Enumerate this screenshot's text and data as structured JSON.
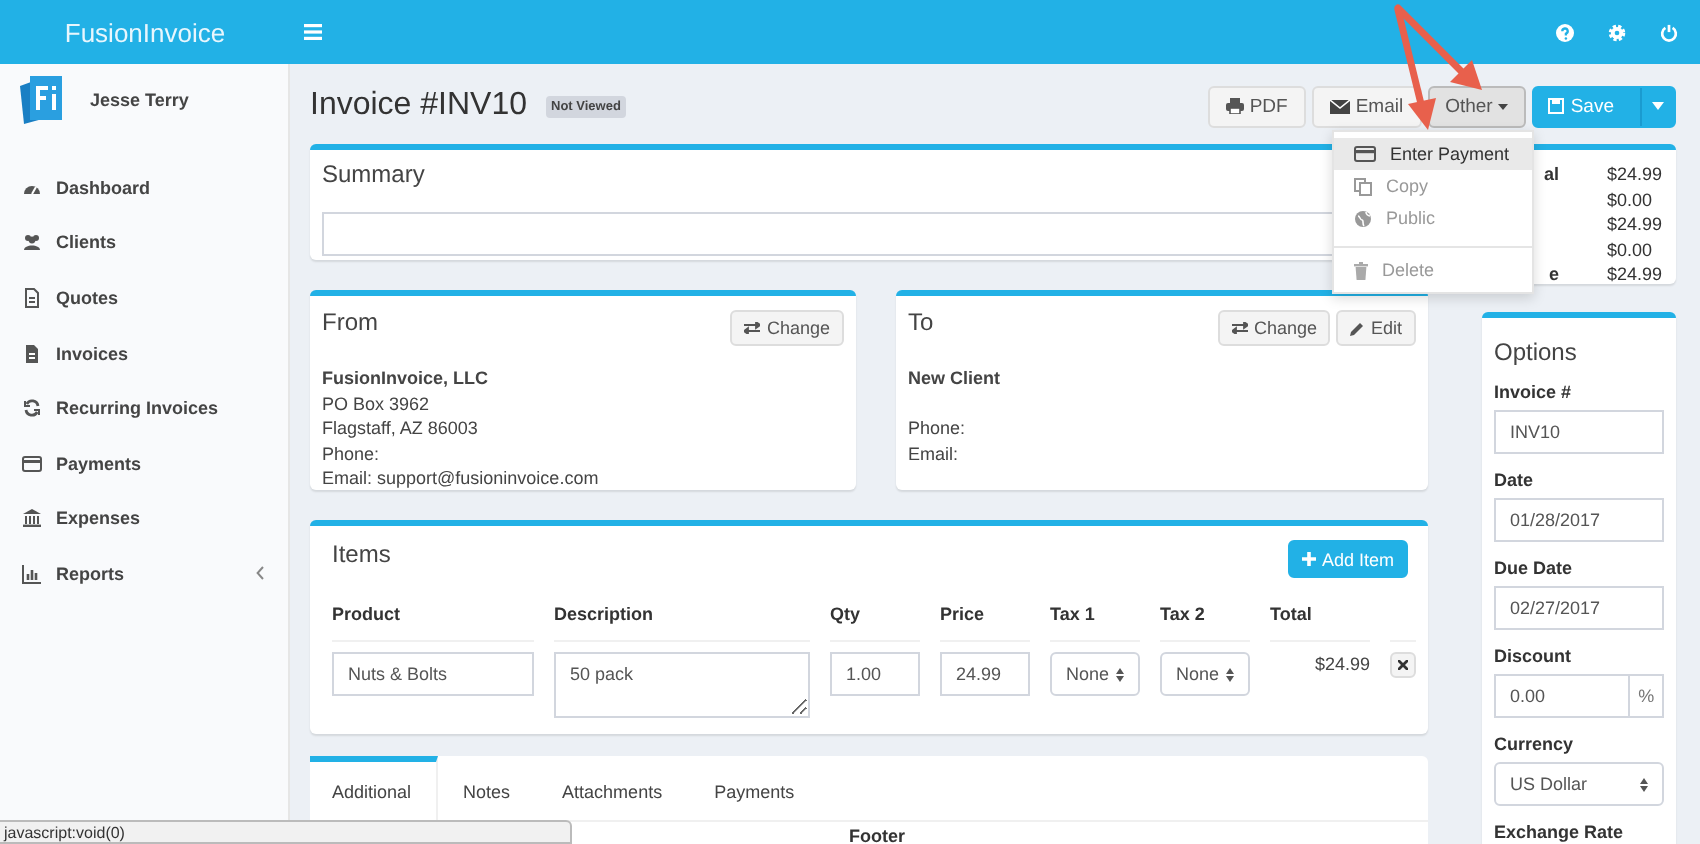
{
  "topbar": {
    "brand": "FusionInvoice"
  },
  "user": {
    "name": "Jesse Terry"
  },
  "sidebar": {
    "items": [
      {
        "label": "Dashboard",
        "expandable": false
      },
      {
        "label": "Clients",
        "expandable": false
      },
      {
        "label": "Quotes",
        "expandable": false
      },
      {
        "label": "Invoices",
        "expandable": false
      },
      {
        "label": "Recurring Invoices",
        "expandable": false
      },
      {
        "label": "Payments",
        "expandable": false
      },
      {
        "label": "Expenses",
        "expandable": false
      },
      {
        "label": "Reports",
        "expandable": true
      }
    ]
  },
  "page": {
    "title": "Invoice #INV10",
    "status_badge": "Not Viewed"
  },
  "actions": [
    {
      "label": "PDF",
      "kind": "default"
    },
    {
      "label": "Email",
      "kind": "default"
    },
    {
      "label": "Other",
      "kind": "dropdown",
      "pressed": true
    },
    {
      "label": "Save",
      "kind": "primary"
    }
  ],
  "dropdown": {
    "items": [
      {
        "label": "Enter Payment",
        "highlighted": true,
        "divider_before": false
      },
      {
        "label": "Copy",
        "highlighted": false,
        "divider_before": false
      },
      {
        "label": "Public",
        "highlighted": false,
        "divider_before": false
      },
      {
        "label": "Delete",
        "highlighted": false,
        "divider_before": true
      }
    ]
  },
  "summary": {
    "title": "Summary"
  },
  "from": {
    "title": "From",
    "name": "FusionInvoice, LLC",
    "lines": [
      "PO Box 3962",
      "Flagstaff, AZ 86003",
      "Phone:",
      "Email: support@fusioninvoice.com"
    ],
    "buttons": [
      "Change"
    ]
  },
  "to": {
    "title": "To",
    "name": "New Client",
    "lines": [
      "Phone:",
      "Email:"
    ],
    "buttons": [
      "Change",
      "Edit"
    ]
  },
  "items": {
    "title": "Items",
    "add_button": "Add Item",
    "columns": [
      "Product",
      "Description",
      "Qty",
      "Price",
      "Tax 1",
      "Tax 2",
      "Total"
    ],
    "rows": [
      {
        "product": "Nuts & Bolts",
        "description": "50 pack",
        "qty": "1.00",
        "price": "24.99",
        "tax_1": "None",
        "tax_2": "None",
        "total": "$24.99"
      }
    ]
  },
  "tabs": [
    {
      "label": "Additional",
      "selected": true
    },
    {
      "label": "Notes",
      "selected": false
    },
    {
      "label": "Attachments",
      "selected": false
    },
    {
      "label": "Payments",
      "selected": false
    }
  ],
  "footer_label": "Footer",
  "totals": [
    {
      "label": "al",
      "value": "$24.99"
    },
    {
      "value": "$0.00"
    },
    {
      "value": "$24.99"
    },
    {
      "value": "$0.00"
    },
    {
      "label": "e",
      "value": "$24.99"
    }
  ],
  "options": {
    "title": "Options",
    "fields": [
      {
        "label": "Invoice #",
        "value": "INV10",
        "kind": "text"
      },
      {
        "label": "Date",
        "value": "01/28/2017",
        "kind": "text"
      },
      {
        "label": "Due Date",
        "value": "02/27/2017",
        "kind": "text"
      },
      {
        "label": "Discount",
        "value": "0.00",
        "kind": "addon",
        "addon": "%"
      },
      {
        "label": "Currency",
        "value": "US Dollar",
        "kind": "select"
      },
      {
        "label": "Exchange Rate",
        "kind": "label"
      }
    ]
  },
  "status_bar": "javascript:void(0)"
}
